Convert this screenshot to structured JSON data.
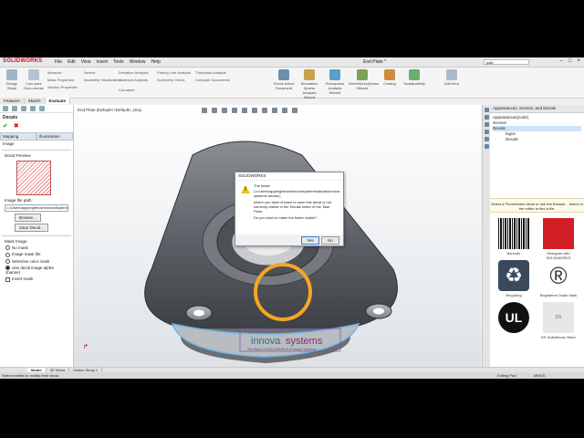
{
  "app": {
    "logo_text": "SOLIDWORKS",
    "doc_title": "End Plate *",
    "search_placeholder": "path"
  },
  "menus": [
    "File",
    "Edit",
    "View",
    "Insert",
    "Tools",
    "Window",
    "Help"
  ],
  "command_manager": {
    "big_buttons": [
      "Design Study",
      "Com-pare Docu-ments",
      "Check Active Document",
      "Simulation Xpress Analysis Wizard",
      "Flowxpress Analysis Wizard",
      "DriveWorksXpress Wizard",
      "Costing",
      "Sustainability",
      "Add Item"
    ],
    "small_buttons": [
      "Measure",
      "Mass Properties",
      "Section Properties",
      "Sensor",
      "Assembly Visualization",
      "Curvature",
      "Deviation Analysis",
      "Undercut Analysis",
      "Parting Line Analysis",
      "Symmetry Check",
      "Thickness Analysis",
      "Compare Documents"
    ]
  },
  "tabs": [
    "Features",
    "Sketch",
    "Evaluate"
  ],
  "tabs_active_index": 2,
  "left_panel": {
    "title": "Decals",
    "subtabs": [
      "Mapping",
      "Illumination"
    ],
    "image_label": "Image",
    "decal_preview_label": "Decal Preview",
    "file_path_label": "Image file path:",
    "file_path_value": "C:\\Users\\appsrightnow\\InnovaSystems\\Decals\\decal",
    "browse_label": "Browse...",
    "save_decal_label": "Save Decal...",
    "mask_image_label": "Mask Image",
    "mask_options": [
      "No mask",
      "Image mask file",
      "Selective color mask",
      "Use decal image alpha channel"
    ],
    "mask_selected_index": 3,
    "invert_mask_label": "Invert mask"
  },
  "viewport": {
    "tree_label": "End Plate (Default<<Default>_Disp"
  },
  "dialog": {
    "title": "SOLIDWORKS",
    "line1": "The folder",
    "line2": "('c:\\users\\appsrightnow\\innovasystems\\decals\\innova systems decals')",
    "line3": "where you have chosen to save this decal is not currently visible in the Decals folder of the Task Pane.",
    "line4": "Do you wish to make the folder visible?",
    "yes_label": "Yes",
    "no_label": "No"
  },
  "decal_text": {
    "brand_a": "innova",
    "brand_b": "systems",
    "tagline": "The Home of SOLIDWORKS & Design Solutions"
  },
  "bottom_tabs": [
    "Model",
    "3D Views",
    "Motion Study 1"
  ],
  "bottom_active_index": 0,
  "status": {
    "left": "Select entities to modify their decal",
    "mid": "Editing Part",
    "right": "MMGS"
  },
  "task_pane": {
    "title": "Appearances, Scenes, and Decals",
    "tree": [
      "Appearances(color)",
      "Scenes",
      "Decals",
      "logos",
      "Decals"
    ],
    "message": "Select a PhotoWorks decal or use the Browse... button in the editor to find a file.",
    "thumbs": [
      "Barcode",
      "Designed with SOLIDWORKS",
      "Recycling",
      "Registered Trade Mark",
      "",
      "DS SolidWorks Silver"
    ]
  },
  "colors": {
    "accent": "#c8102e",
    "highlight_ring": "#f5a623",
    "dialog_warn": "#f2c200"
  }
}
